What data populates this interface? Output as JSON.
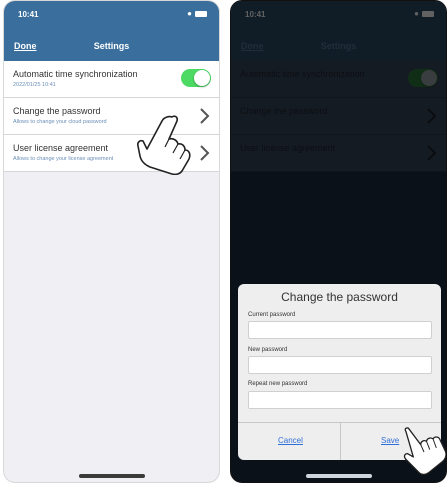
{
  "status": {
    "time": "10:41"
  },
  "nav": {
    "done_label": "Done",
    "title": "Settings"
  },
  "rows": [
    {
      "label": "Automatic time synchronization",
      "sub": "2022/01/25 10:41"
    },
    {
      "label": "Change the password",
      "sub": "Allows to change your cloud password"
    },
    {
      "label": "User license agreement",
      "sub": "Allows to change your license agreement"
    }
  ],
  "dialog": {
    "title": "Change the password",
    "fields": [
      {
        "label": "Current password",
        "value": ""
      },
      {
        "label": "New password",
        "value": ""
      },
      {
        "label": "Repeat new password",
        "value": ""
      }
    ],
    "cancel_label": "Cancel",
    "save_label": "Save"
  },
  "colors": {
    "header": "#3a6e9c",
    "toggle_on": "#4cd964",
    "link": "#2f6fd8"
  },
  "icons": [
    "chevron-right-icon",
    "pointing-hand-icon",
    "wifi-icon",
    "battery-icon"
  ]
}
